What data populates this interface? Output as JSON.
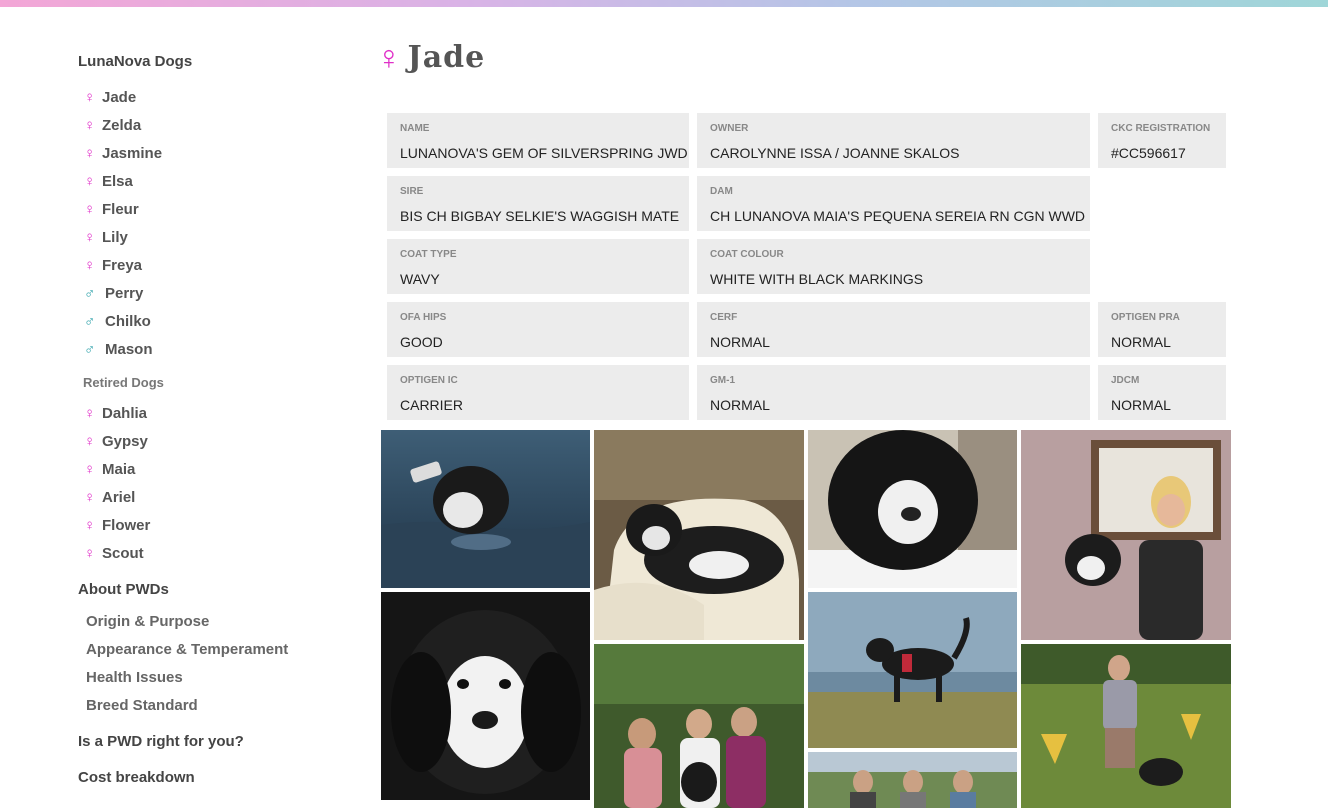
{
  "sidebar": {
    "heading": "LunaNova Dogs",
    "dogs": [
      {
        "name": "Jade",
        "sex": "female"
      },
      {
        "name": "Zelda",
        "sex": "female"
      },
      {
        "name": "Jasmine",
        "sex": "female"
      },
      {
        "name": "Elsa",
        "sex": "female"
      },
      {
        "name": "Fleur",
        "sex": "female"
      },
      {
        "name": "Lily",
        "sex": "female"
      },
      {
        "name": "Freya",
        "sex": "female"
      },
      {
        "name": "Perry",
        "sex": "male"
      },
      {
        "name": "Chilko",
        "sex": "male"
      },
      {
        "name": "Mason",
        "sex": "male"
      }
    ],
    "retired_heading": "Retired Dogs",
    "retired": [
      {
        "name": "Dahlia",
        "sex": "female"
      },
      {
        "name": "Gypsy",
        "sex": "female"
      },
      {
        "name": "Maia",
        "sex": "female"
      },
      {
        "name": "Ariel",
        "sex": "female"
      },
      {
        "name": "Flower",
        "sex": "female"
      },
      {
        "name": "Scout",
        "sex": "female"
      }
    ],
    "about_heading": "About PWDs",
    "about_links": [
      "Origin & Purpose",
      "Appearance & Temperament",
      "Health Issues",
      "Breed Standard"
    ],
    "right_for_you": "Is a PWD right for you?",
    "cost": "Cost breakdown"
  },
  "symbols": {
    "female": "♀",
    "male": "♂"
  },
  "colors": {
    "female": "#e02fc8",
    "male": "#2aa0a8",
    "cell_bg": "#ececec"
  },
  "page": {
    "title": "Jade",
    "sex": "female"
  },
  "info": {
    "name": {
      "label": "NAME",
      "value": "LUNANOVA'S GEM OF SILVERSPRING JWD"
    },
    "owner": {
      "label": "OWNER",
      "value": "CAROLYNNE ISSA / JOANNE SKALOS"
    },
    "ckc": {
      "label": "CKC REGISTRATION",
      "value": "#CC596617"
    },
    "sire": {
      "label": "SIRE",
      "value": "BIS CH BIGBAY SELKIE'S WAGGISH MATE"
    },
    "dam": {
      "label": "DAM",
      "value": "CH LUNANOVA MAIA'S PEQUENA SEREIA RN CGN WWD"
    },
    "coat_type": {
      "label": "COAT TYPE",
      "value": "WAVY"
    },
    "coat_colour": {
      "label": "COAT COLOUR",
      "value": "WHITE WITH BLACK MARKINGS"
    },
    "ofa_hips": {
      "label": "OFA HIPS",
      "value": "GOOD"
    },
    "cerf": {
      "label": "CERF",
      "value": "NORMAL"
    },
    "optigen_pra": {
      "label": "OPTIGEN PRA",
      "value": "NORMAL"
    },
    "optigen_ic": {
      "label": "OPTIGEN IC",
      "value": "CARRIER"
    },
    "gm1": {
      "label": "GM-1",
      "value": "NORMAL"
    },
    "jdcm": {
      "label": "JDCM",
      "value": "NORMAL"
    }
  }
}
